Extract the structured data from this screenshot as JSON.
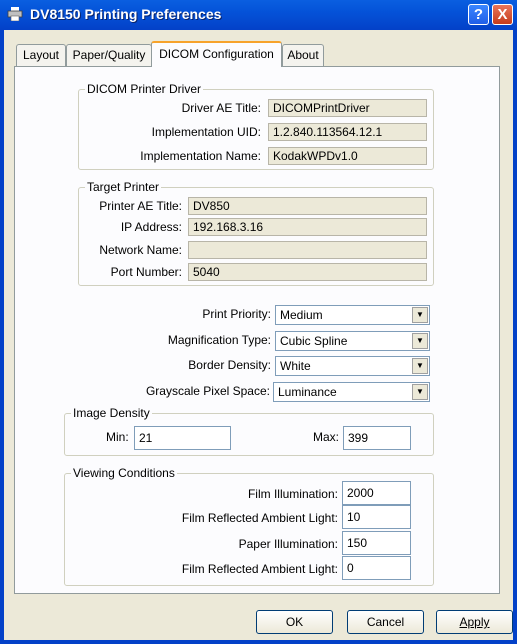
{
  "window": {
    "title": "DV8150 Printing Preferences",
    "help": "?",
    "close": "X"
  },
  "tabs": [
    {
      "label": "Layout"
    },
    {
      "label": "Paper/Quality"
    },
    {
      "label": "DICOM Configuration"
    },
    {
      "label": "About"
    }
  ],
  "driver": {
    "group": "DICOM Printer Driver",
    "ae_title_label": "Driver AE Title:",
    "ae_title": "DICOMPrintDriver",
    "uid_label": "Implementation UID:",
    "uid": "1.2.840.113564.12.1",
    "name_label": "Implementation Name:",
    "name": "KodakWPDv1.0"
  },
  "target": {
    "group": "Target Printer",
    "ae_title_label": "Printer AE Title:",
    "ae_title": "DV850",
    "ip_label": "IP Address:",
    "ip": "192.168.3.16",
    "network_label": "Network Name:",
    "network": "",
    "port_label": "Port Number:",
    "port": "5040"
  },
  "print": {
    "priority_label": "Print Priority:",
    "priority": "Medium",
    "magnification_label": "Magnification Type:",
    "magnification": "Cubic Spline",
    "border_label": "Border Density:",
    "border": "White",
    "grayscale_label": "Grayscale Pixel Space:",
    "grayscale": "Luminance"
  },
  "density": {
    "group": "Image Density",
    "min_label": "Min:",
    "min": "21",
    "max_label": "Max:",
    "max": "399"
  },
  "viewing": {
    "group": "Viewing Conditions",
    "film_illum_label": "Film Illumination:",
    "film_illum": "2000",
    "film_ambient_label": "Film Reflected Ambient Light:",
    "film_ambient": "10",
    "paper_illum_label": "Paper Illumination:",
    "paper_illum": "150",
    "film_ambient2_label": "Film Reflected Ambient Light:",
    "film_ambient2": "0"
  },
  "buttons": {
    "ok": "OK",
    "cancel": "Cancel",
    "apply": "Apply"
  }
}
